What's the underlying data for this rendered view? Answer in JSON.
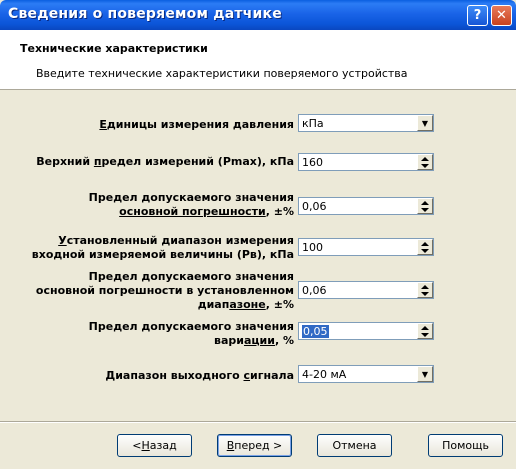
{
  "window": {
    "title": "Сведения о поверяемом датчике",
    "help_label": "?",
    "close_label": "✕"
  },
  "header": {
    "title": "Технические характеристики",
    "subtitle": "Введите технические характеристики поверяемого устройства"
  },
  "fields": {
    "units": {
      "label_pre": "",
      "label_u": "Е",
      "label_post": "диницы измерения давления",
      "value": "кПа"
    },
    "upper_limit": {
      "label_pre": "Верхний ",
      "label_u": "п",
      "label_post": "редел измерений (Pmax), кПа",
      "value": "160"
    },
    "basic_error": {
      "line1": "Предел допускаемого значения",
      "line2_u": "основной погрешности",
      "line2_post": ", ±%",
      "value": "0,06"
    },
    "range": {
      "line1_u": "У",
      "line1_post": "становленный диапазон измерения",
      "line2": "входной измеряемой величины (Pв), кПа",
      "value": "100"
    },
    "range_error": {
      "line1": "Предел допускаемого значения",
      "line2": "основной погрешности в установленном",
      "line3_pre": "диап",
      "line3_u": "азоне",
      "line3_post": ", ±%",
      "value": "0,06"
    },
    "variation": {
      "line1": "Предел допускаемого значения",
      "line2_pre": "вари",
      "line2_u": "ации",
      "line2_post": ", %",
      "value": "0,05"
    },
    "output": {
      "label_pre": "Диапазон выходного ",
      "label_u": "с",
      "label_post": "игнала",
      "value": "4-20 мА"
    }
  },
  "buttons": {
    "back_pre": "< ",
    "back_u": "Н",
    "back_post": "азад",
    "next_u": "В",
    "next_post": "перед >",
    "cancel": "Отмена",
    "help": "Помощь"
  }
}
